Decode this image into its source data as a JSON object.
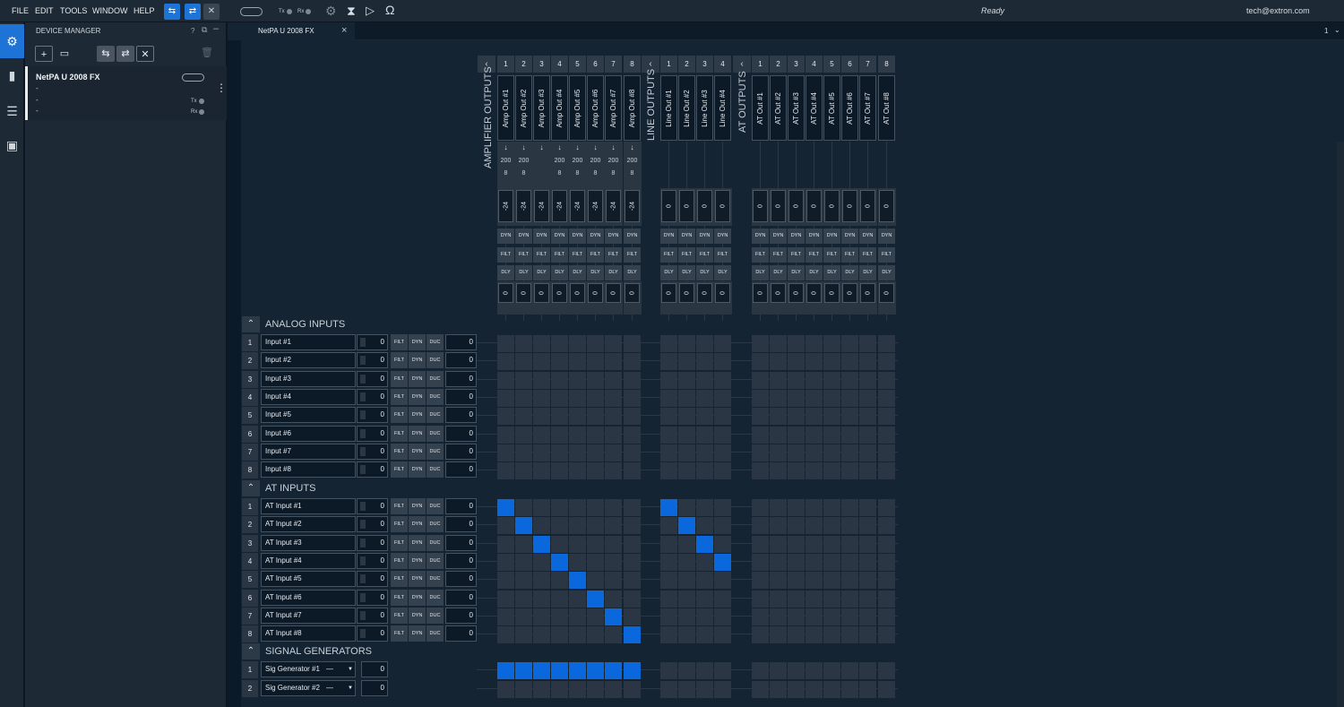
{
  "menubar": {
    "items": [
      "FILE",
      "EDIT",
      "TOOLS",
      "WINDOW",
      "HELP"
    ],
    "tx_label": "Tx",
    "rx_label": "Rx",
    "status": "Ready",
    "user": "tech@extron.com"
  },
  "device_manager": {
    "title": "DEVICE MANAGER",
    "help": "?",
    "device": {
      "name": "NetPA U 2008 FX",
      "line1": "-",
      "line2": "-",
      "line3": "-",
      "tx": "Tx",
      "rx": "Rx"
    }
  },
  "tab": {
    "label": "NetPA U 2008 FX",
    "close": "×",
    "page_selector": "1"
  },
  "groups": {
    "amplifier_outputs": "AMPLIFIER OUTPUTS",
    "line_outputs": "LINE OUTPUTS",
    "at_outputs": "AT OUTPUTS"
  },
  "amp_outputs": [
    "Amp Out #1",
    "Amp Out #2",
    "Amp Out #3",
    "Amp Out #4",
    "Amp Out #5",
    "Amp Out #6",
    "Amp Out #7",
    "Amp Out #8"
  ],
  "line_outputs": [
    "Line Out #1",
    "Line Out #2",
    "Line Out #3",
    "Line Out #4"
  ],
  "at_outputs": [
    "AT Out #1",
    "AT Out #2",
    "AT Out #3",
    "AT Out #4",
    "AT Out #5",
    "AT Out #6",
    "AT Out #7",
    "AT Out #8"
  ],
  "amp_power": [
    "200",
    "200",
    "",
    "200",
    "200",
    "200",
    "200",
    "200"
  ],
  "amp_power_present": [
    true,
    true,
    false,
    true,
    true,
    true,
    true,
    true
  ],
  "amp_ohm": "8",
  "amp_gain": "-24",
  "other_gain": "0",
  "output_buttons": {
    "dyn": "DYN",
    "filt": "FILT",
    "dly": "DLY"
  },
  "output_delay": "0",
  "sections": {
    "analog": "ANALOG INPUTS",
    "at": "AT INPUTS",
    "siggen": "SIGNAL GENERATORS"
  },
  "row_buttons": {
    "filt": "FILT",
    "dyn": "DYN",
    "duc": "DUC"
  },
  "analog_inputs": [
    "Input #1",
    "Input #2",
    "Input #3",
    "Input #4",
    "Input #5",
    "Input #6",
    "Input #7",
    "Input #8"
  ],
  "at_inputs": [
    "AT Input #1",
    "AT Input #2",
    "AT Input #3",
    "AT Input #4",
    "AT Input #5",
    "AT Input #6",
    "AT Input #7",
    "AT Input #8"
  ],
  "sig_generators": [
    {
      "name": "Sig Generator #1",
      "mode": "—",
      "value": "0"
    },
    {
      "name": "Sig Generator #2",
      "mode": "—",
      "value": "0"
    }
  ],
  "input_gain": "0",
  "input_delay": "0",
  "routing": {
    "at_to_amp": [
      0,
      1,
      2,
      3,
      4,
      5,
      6,
      7
    ],
    "at_to_line": [
      0,
      1,
      2,
      3
    ],
    "siggen1_to_amp": [
      0,
      1,
      2,
      3,
      4,
      5,
      6,
      7
    ]
  }
}
